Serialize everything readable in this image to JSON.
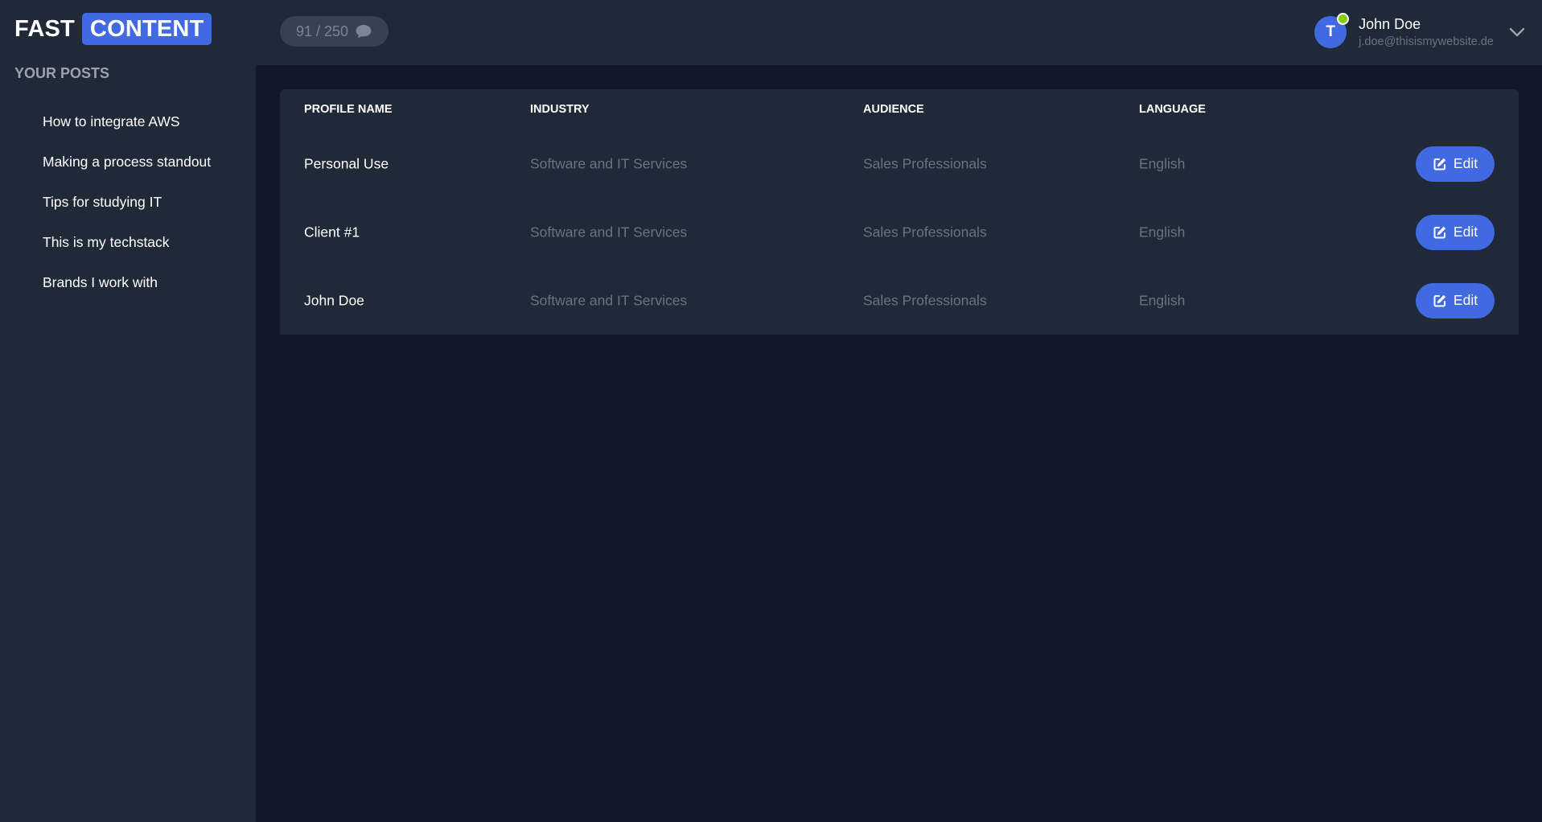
{
  "brand": {
    "part1": "FAST",
    "part2": "CONTENT"
  },
  "sidebar": {
    "title": "YOUR POSTS",
    "posts": [
      "How to integrate AWS",
      "Making a process standout",
      "Tips for studying IT",
      "This is my techstack",
      "Brands I work with"
    ]
  },
  "header": {
    "credits": "91 / 250",
    "credits_icon": "chat-bubble-icon",
    "user": {
      "initial": "T",
      "name": "John Doe",
      "email": "j.doe@thisismywebsite.de",
      "status": "online"
    }
  },
  "table": {
    "columns": [
      "PROFILE NAME",
      "INDUSTRY",
      "AUDIENCE",
      "LANGUAGE"
    ],
    "edit_label": "Edit",
    "rows": [
      {
        "name": "Personal Use",
        "industry": "Software and IT Services",
        "audience": "Sales Professionals",
        "language": "English"
      },
      {
        "name": "Client #1",
        "industry": "Software and IT Services",
        "audience": "Sales Professionals",
        "language": "English"
      },
      {
        "name": "John Doe",
        "industry": "Software and IT Services",
        "audience": "Sales Professionals",
        "language": "English"
      }
    ]
  },
  "colors": {
    "accent": "#4169e1",
    "background": "#111827",
    "panel": "#1f2937",
    "status_online": "#84cc16"
  }
}
